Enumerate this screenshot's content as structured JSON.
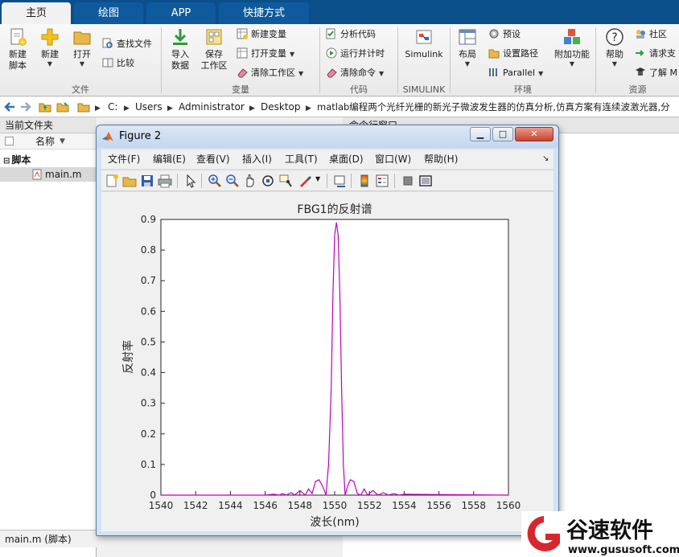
{
  "tabs": [
    {
      "label": "主页",
      "active": true
    },
    {
      "label": "绘图",
      "active": false
    },
    {
      "label": "APP",
      "active": false
    },
    {
      "label": "快捷方式",
      "active": false
    }
  ],
  "ribbon": {
    "file": {
      "new_script": "新建\n脚本",
      "new": "新建",
      "open": "打开",
      "find_files": "查找文件",
      "compare": "比较",
      "section": "文件"
    },
    "variable": {
      "import": "导入\n数据",
      "save_ws": "保存\n工作区",
      "new_var": "新建变量",
      "open_var": "打开变量",
      "clear_ws": "清除工作区",
      "section": "变量"
    },
    "code": {
      "analyze": "分析代码",
      "run_time": "运行并计时",
      "clear_cmds": "清除命令",
      "section": "代码"
    },
    "simulink": {
      "label": "Simulink",
      "section": "SIMULINK"
    },
    "env": {
      "layout": "布局",
      "prefs": "预设",
      "set_path": "设置路径",
      "parallel": "Parallel",
      "addons": "附加功能",
      "section": "环境"
    },
    "resources": {
      "help": "帮助",
      "community": "社区",
      "request_support": "请求支",
      "learn": "了解 M",
      "section": "资源"
    }
  },
  "address": {
    "crumbs": [
      "C:",
      "Users",
      "Administrator",
      "Desktop",
      "matlab编程两个光纤光栅的新光子微波发生器的仿真分析,仿真方案有连续波激光器,分"
    ]
  },
  "left_panel": {
    "title": "当前文件夹",
    "column": "名称",
    "group": "脚本",
    "file": "main.m",
    "details": "main.m  (脚本)"
  },
  "cmd_window": {
    "title": "命令行窗口"
  },
  "figure": {
    "title": "Figure 2",
    "menus": [
      "文件(F)",
      "编辑(E)",
      "查看(V)",
      "插入(I)",
      "工具(T)",
      "桌面(D)",
      "窗口(W)",
      "帮助(H)"
    ],
    "icons": [
      "new-figure-icon",
      "open-file-icon",
      "save-icon",
      "print-icon",
      "pointer-icon",
      "zoom-in-icon",
      "zoom-out-icon",
      "pan-hand-icon",
      "rotate-3d-icon",
      "data-cursor-icon",
      "brush-icon",
      "link-plot-icon",
      "colorbar-icon",
      "legend-icon",
      "hide-plot-tools-icon",
      "show-plot-tools-icon"
    ]
  },
  "chart_data": {
    "type": "line",
    "title": "FBG1的反射谱",
    "xlabel": "波长(nm)",
    "ylabel": "反射率",
    "xlim": [
      1540,
      1560
    ],
    "ylim": [
      0,
      0.9
    ],
    "xticks": [
      "1540",
      "1542",
      "1544",
      "1546",
      "1548",
      "1550",
      "1552",
      "1554",
      "1556",
      "1558",
      "1560"
    ],
    "yticks": [
      "0",
      "0.1",
      "0.2",
      "0.3",
      "0.4",
      "0.5",
      "0.6",
      "0.7",
      "0.8",
      "0.9"
    ],
    "line_color": "#bf00bf",
    "grid": false,
    "series": [
      {
        "x": [
          1540,
          1546,
          1546.5,
          1546.8,
          1547,
          1547.2,
          1547.5,
          1547.7,
          1548,
          1548.3,
          1548.5,
          1548.7,
          1548.9,
          1549.1,
          1549.3,
          1549.5,
          1549.65,
          1549.8,
          1549.9,
          1550,
          1550.1,
          1550.2,
          1550.3,
          1550.4,
          1550.5,
          1550.6,
          1550.75,
          1550.9,
          1551.1,
          1551.3,
          1551.5,
          1551.7,
          1551.9,
          1552.2,
          1552.5,
          1552.8,
          1553.1,
          1553.4,
          1553.7,
          1554,
          1560
        ],
        "y": [
          0,
          0,
          0.003,
          0,
          0.005,
          0,
          0.008,
          0,
          0.015,
          0,
          0.02,
          0.005,
          0.045,
          0.05,
          0.03,
          0,
          0.1,
          0.35,
          0.65,
          0.85,
          0.89,
          0.85,
          0.65,
          0.35,
          0.1,
          0,
          0.03,
          0.05,
          0.045,
          0.005,
          0,
          0.02,
          0,
          0.015,
          0,
          0.008,
          0,
          0.005,
          0,
          0.003,
          0
        ]
      }
    ]
  }
}
